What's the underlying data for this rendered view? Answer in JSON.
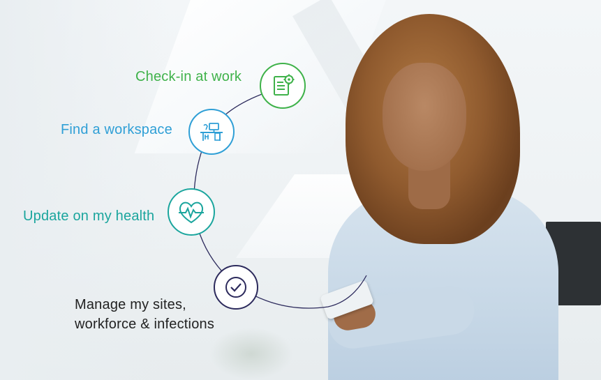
{
  "steps": [
    {
      "label": "Check-in at work",
      "icon": "checkin-form-icon",
      "color": "#3fb24a"
    },
    {
      "label": "Find a workspace",
      "icon": "workspace-desk-icon",
      "color": "#2f9fd6"
    },
    {
      "label": "Update on my health",
      "icon": "heart-pulse-icon",
      "color": "#1aa59d"
    },
    {
      "label": "Manage my sites,",
      "label_line2": "workforce & infections",
      "icon": "check-circle-icon",
      "color": "#2c2a5c"
    }
  ],
  "colors": {
    "text_dark": "#222222",
    "arc": "#2c2a5c"
  }
}
